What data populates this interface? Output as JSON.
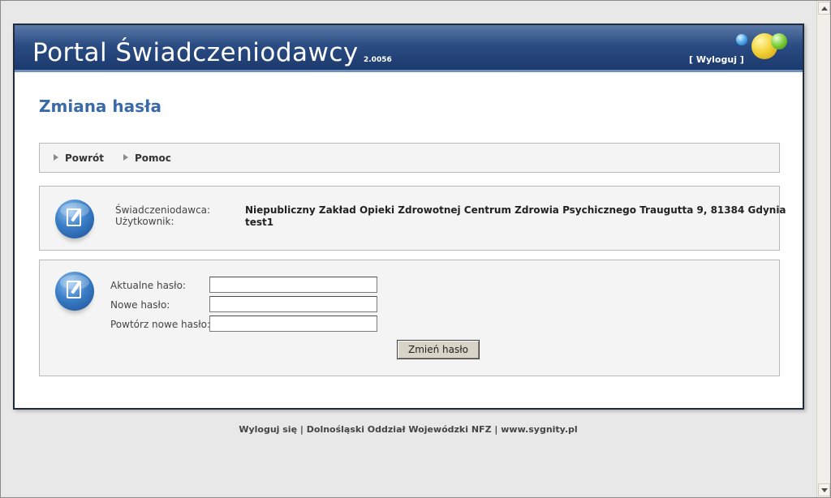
{
  "header": {
    "title": "Portal Świadczeniodawcy",
    "version": "2.0056",
    "logout": "[ Wyloguj ]"
  },
  "page_title": "Zmiana hasła",
  "nav": [
    {
      "label": "Powrót",
      "icon": "triangle-right-icon"
    },
    {
      "label": "Pomoc",
      "icon": "triangle-right-icon"
    }
  ],
  "info": {
    "provider_label": "Świadczeniodawca:",
    "provider_value": "Niepubliczny Zakład Opieki Zdrowotnej Centrum Zdrowia Psychicznego Traugutta 9, 81384 Gdynia",
    "user_label": "Użytkownik:",
    "user_value": "test1",
    "icon": "document-edit-icon"
  },
  "form": {
    "icon": "document-edit-icon",
    "current_password_label": "Aktualne hasło:",
    "current_password_value": "",
    "new_password_label": "Nowe hasło:",
    "new_password_value": "",
    "repeat_password_label": "Powtórz nowe hasło:",
    "repeat_password_value": "",
    "submit_label": "Zmień hasło"
  },
  "footer": {
    "logout": "Wyloguj się",
    "separator": "|",
    "org": "Dolnośląski Oddział Wojewódzki NFZ",
    "site": "www.sygnity.pl"
  },
  "colors": {
    "banner": "#2a4c82",
    "title": "#3a6aa8",
    "box_background": "#f4f4f4"
  }
}
